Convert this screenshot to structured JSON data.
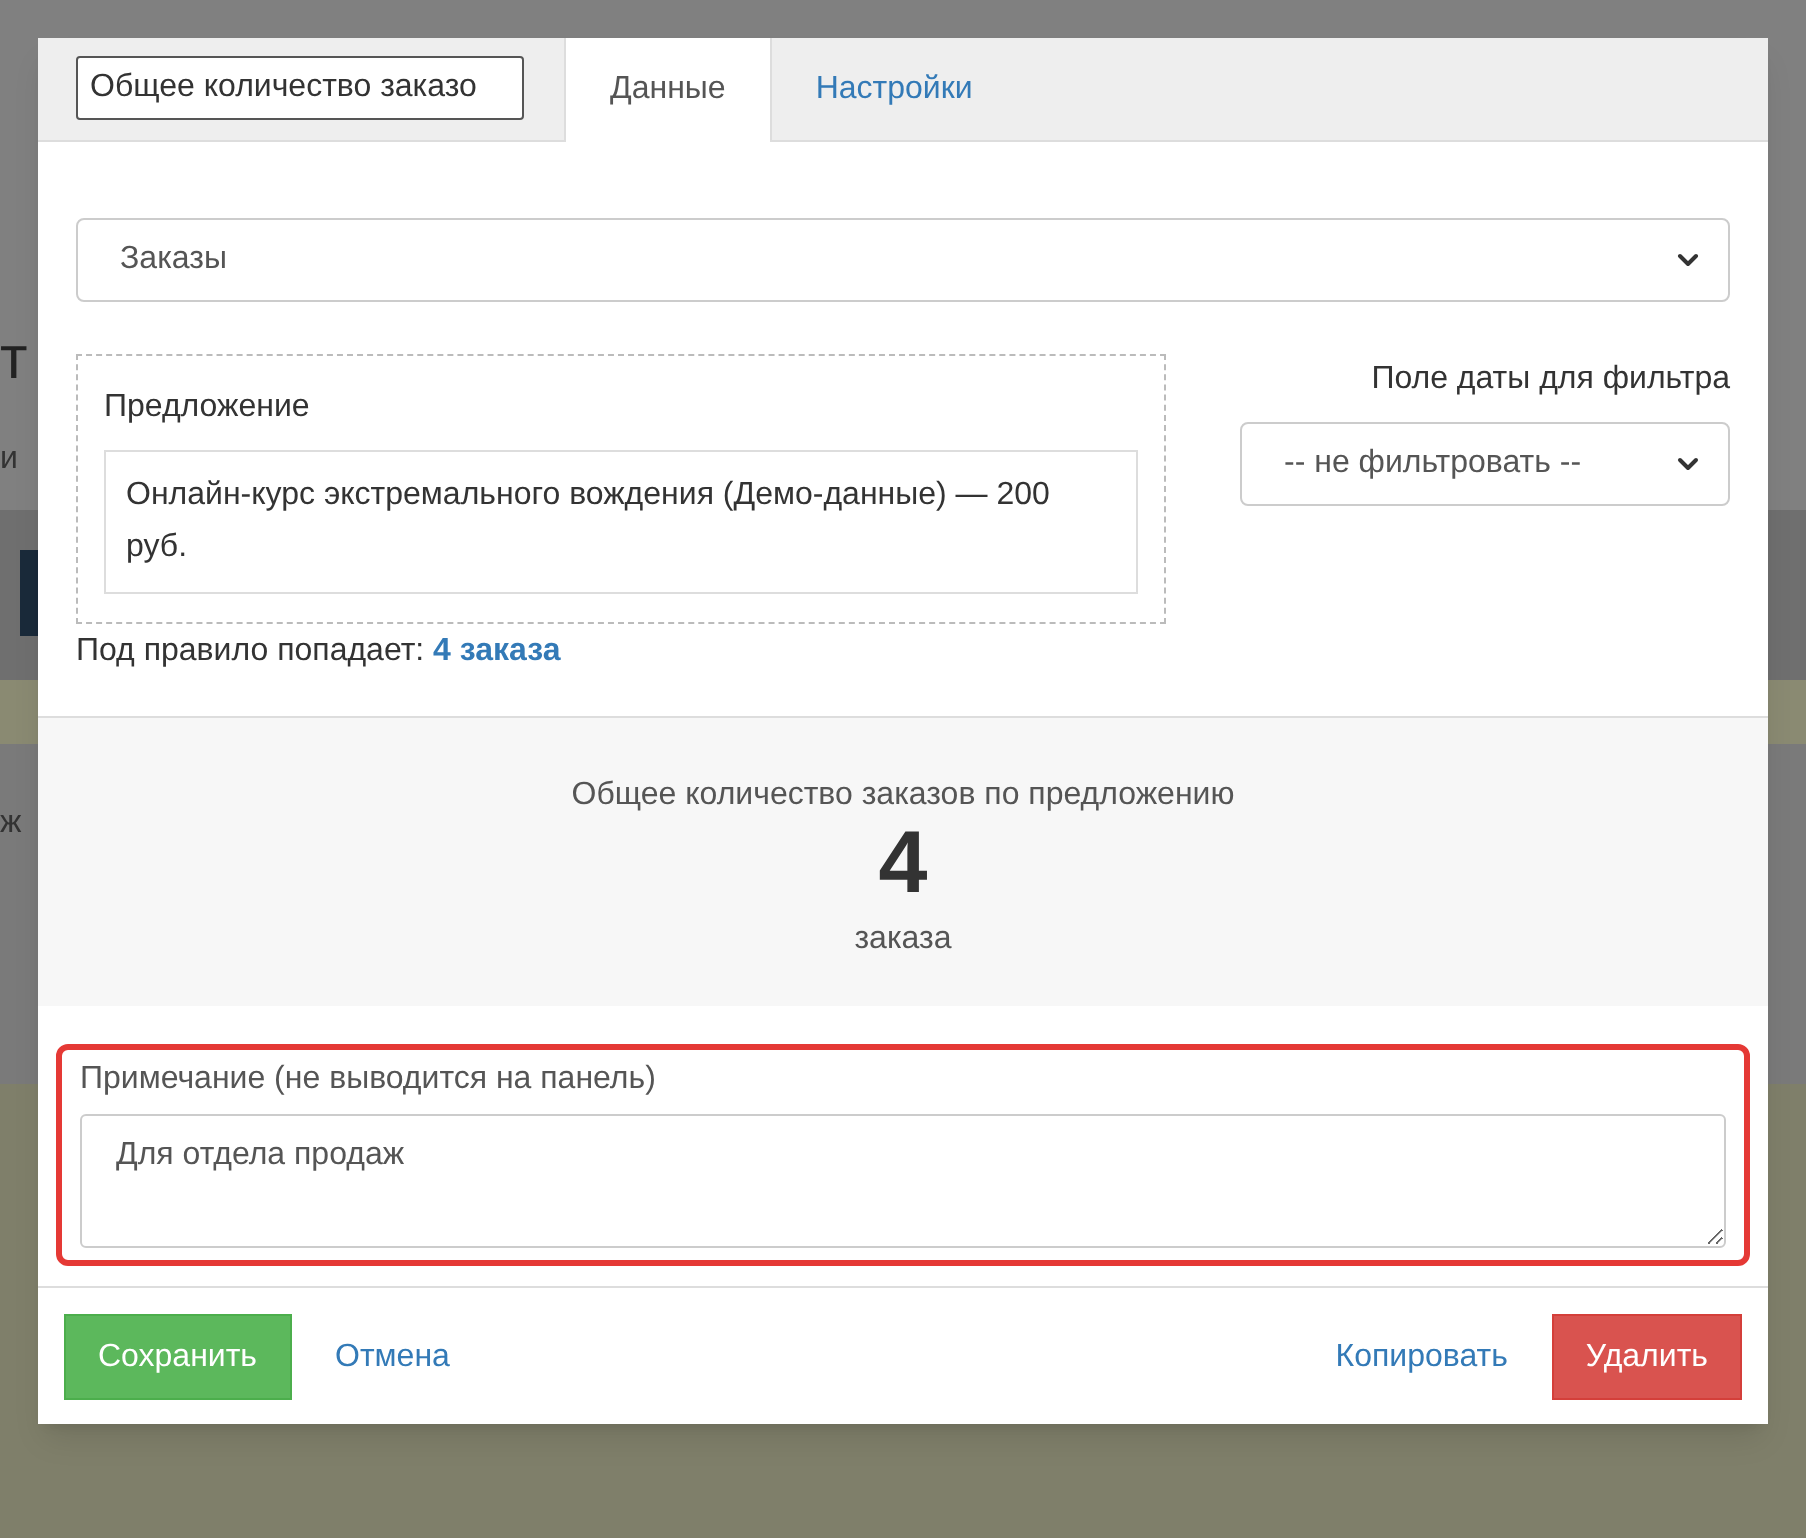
{
  "background": {
    "fragments": [
      "т",
      "и",
      "ж"
    ]
  },
  "modal": {
    "title_field": {
      "value": "Общее количество заказо"
    },
    "tabs": [
      {
        "label": "Данные",
        "selected": true
      },
      {
        "label": "Настройки",
        "selected": false
      }
    ],
    "source_select": {
      "value": "Заказы"
    },
    "offer": {
      "label": "Предложение",
      "value": "Онлайн-курс экстремального вождения (Демо-данные) — 200 руб."
    },
    "date_filter": {
      "label": "Поле даты для фильтра",
      "value": "-- не фильтровать --"
    },
    "match": {
      "text": "Под правило попадает:",
      "link": "4 заказа"
    },
    "summary": {
      "caption": "Общее количество заказов по предложению",
      "count": "4",
      "unit": "заказа"
    },
    "note": {
      "label": "Примечание (не выводится на панель)",
      "value": "Для отдела продаж",
      "highlighted": true
    },
    "footer": {
      "left": [
        {
          "label": "Сохранить",
          "kind": "success"
        },
        {
          "label": "Отмена",
          "kind": "link"
        }
      ],
      "right": [
        {
          "label": "Копировать",
          "kind": "link"
        },
        {
          "label": "Удалить",
          "kind": "danger"
        }
      ]
    }
  }
}
